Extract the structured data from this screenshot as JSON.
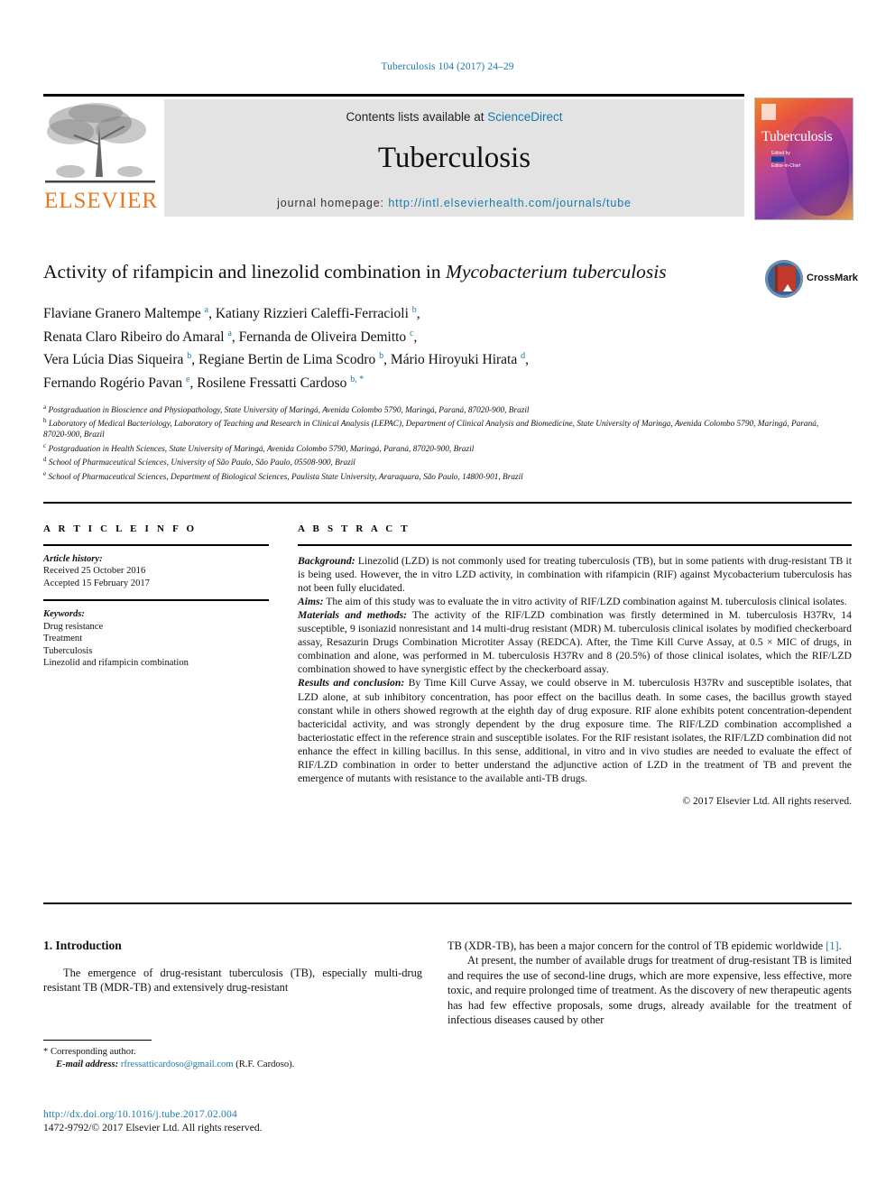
{
  "running_head": "Tuberculosis 104 (2017) 24–29",
  "masthead": {
    "publisher_logo_text": "ELSEVIER",
    "contents_prefix": "Contents lists available at ",
    "contents_link": "ScienceDirect",
    "journal_title": "Tuberculosis",
    "homepage_prefix": "journal homepage: ",
    "homepage_url": "http://intl.elsevierhealth.com/journals/tube",
    "cover": {
      "title": "Tuberculosis",
      "sub_line1": "Edited by",
      "sub_line2": "Editor-in-Chief"
    }
  },
  "article": {
    "title_part1": "Activity of rifampicin and linezolid combination in ",
    "title_italic": "Mycobacterium tuberculosis",
    "crossmark_label": "CrossMark",
    "authors_lines": [
      "Flaviane Granero Maltempe a, Katiany Rizzieri Caleffi-Ferracioli b,",
      "Renata Claro Ribeiro do Amaral a, Fernanda de Oliveira Demitto c,",
      "Vera Lúcia Dias Siqueira b, Regiane Bertin de Lima Scodro b, Mário Hiroyuki Hirata d,",
      "Fernando Rogério Pavan e, Rosilene Fressatti Cardoso b, *"
    ],
    "affiliations": [
      {
        "mark": "a",
        "text": "Postgraduation in Bioscience and Physiopathology, State University of Maringá, Avenida Colombo 5790, Maringá, Paraná, 87020-900, Brazil"
      },
      {
        "mark": "b",
        "text": "Laboratory of Medical Bacteriology, Laboratory of Teaching and Research in Clinical Analysis (LEPAC), Department of Clinical Analysis and Biomedicine, State University of Maringa, Avenida Colombo 5790, Maringá, Paraná, 87020-900, Brazil"
      },
      {
        "mark": "c",
        "text": "Postgraduation in Health Sciences, State University of Maringá, Avenida Colombo 5790, Maringá, Paraná, 87020-900, Brazil"
      },
      {
        "mark": "d",
        "text": "School of Pharmaceutical Sciences, University of São Paulo, São Paulo, 05508-900, Brazil"
      },
      {
        "mark": "e",
        "text": "School of Pharmaceutical Sciences, Department of Biological Sciences, Paulista State University, Araraquara, São Paulo, 14800-901, Brazil"
      }
    ]
  },
  "article_info": {
    "heading": "A R T I C L E   I N F O",
    "history_label": "Article history:",
    "received": "Received 25 October 2016",
    "accepted": "Accepted 15 February 2017",
    "keywords_label": "Keywords:",
    "keywords": [
      "Drug resistance",
      "Treatment",
      "Tuberculosis",
      "Linezolid and rifampicin combination"
    ]
  },
  "abstract": {
    "heading": "A B S T R A C T",
    "background_label": "Background:",
    "background_text": " Linezolid (LZD) is not commonly used for treating tuberculosis (TB), but in some patients with drug-resistant TB it is being used. However, the in vitro LZD activity, in combination with rifampicin (RIF) against Mycobacterium tuberculosis has not been fully elucidated.",
    "aims_label": "Aims:",
    "aims_text": " The aim of this study was to evaluate the in vitro activity of RIF/LZD combination against M. tuberculosis clinical isolates.",
    "methods_label": "Materials and methods:",
    "methods_text": " The activity of the RIF/LZD combination was firstly determined in M. tuberculosis H37Rv, 14 susceptible, 9 isoniazid nonresistant and 14 multi-drug resistant (MDR) M. tuberculosis clinical isolates by modified checkerboard assay, Resazurin Drugs Combination Microtiter Assay (REDCA). After, the Time Kill Curve Assay, at 0.5 × MIC of drugs, in combination and alone, was performed in M. tuberculosis H37Rv and 8 (20.5%) of those clinical isolates, which the RIF/LZD combination showed to have synergistic effect by the checkerboard assay.",
    "results_label": "Results and conclusion:",
    "results_text": " By Time Kill Curve Assay, we could observe in M. tuberculosis H37Rv and susceptible isolates, that LZD alone, at sub inhibitory concentration, has poor effect on the bacillus death. In some cases, the bacillus growth stayed constant while in others showed regrowth at the eighth day of drug exposure. RIF alone exhibits potent concentration-dependent bactericidal activity, and was strongly dependent by the drug exposure time. The RIF/LZD combination accomplished a bacteriostatic effect in the reference strain and susceptible isolates. For the RIF resistant isolates, the RIF/LZD combination did not enhance the effect in killing bacillus. In this sense, additional, in vitro and in vivo studies are needed to evaluate the effect of RIF/LZD combination in order to better understand the adjunctive action of LZD in the treatment of TB and prevent the emergence of mutants with resistance to the available anti-TB drugs.",
    "copyright": "© 2017 Elsevier Ltd. All rights reserved."
  },
  "body": {
    "section_heading": "1. Introduction",
    "left_para1": "The emergence of drug-resistant tuberculosis (TB), especially multi-drug resistant TB (MDR-TB) and extensively drug-resistant",
    "right_para1_a": "TB (XDR-TB), has been a major concern for the control of TB epidemic worldwide ",
    "right_para1_ref": "[1]",
    "right_para1_b": ".",
    "right_para2": "At present, the number of available drugs for treatment of drug-resistant TB is limited and requires the use of second-line drugs, which are more expensive, less effective, more toxic, and require prolonged time of treatment. As the discovery of new therapeutic agents has had few effective proposals, some drugs, already available for the treatment of infectious diseases caused by other"
  },
  "footnote": {
    "corresponding": "* Corresponding author.",
    "email_label": "E-mail address:",
    "email": "rfressatticardoso@gmail.com",
    "email_owner": "(R.F. Cardoso).",
    "doi": "http://dx.doi.org/10.1016/j.tube.2017.02.004",
    "issn": "1472-9792/© 2017 Elsevier Ltd. All rights reserved."
  },
  "colors": {
    "link": "#1a7aad",
    "elsevier_orange": "#E87722",
    "banner_gray": "#e3e3e3"
  }
}
